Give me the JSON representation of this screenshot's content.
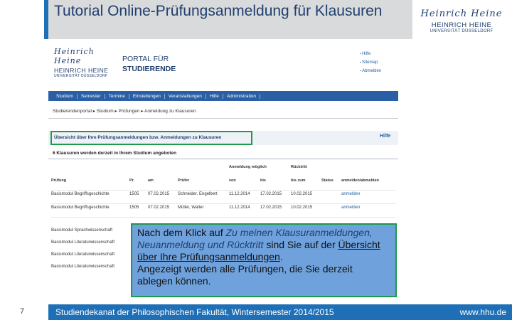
{
  "slide": {
    "title": "Tutorial Online-Prüfungsanmeldung für Klausuren",
    "page_number": "7",
    "footer_text": "Studiendekanat der Philosophischen Fakultät, Wintersemester 2014/2015",
    "footer_url": "www.hhu.de",
    "colors": {
      "accent_blue": "#1f6fb7",
      "title_band": "#d9dadb",
      "callout_bg": "#6fa1dc",
      "highlight_green": "#1f9a4a"
    }
  },
  "logo": {
    "script": "Heinrich Heine",
    "name": "HEINRICH HEINE",
    "sub": "UNIVERSITÄT DÜSSELDORF"
  },
  "portal": {
    "heading_line1": "PORTAL FÜR",
    "heading_line2": "STUDIERENDE",
    "quick_links": [
      "Hilfe",
      "Sitemap",
      "Abmelden"
    ],
    "nav_items": [
      "Studium",
      "Semester",
      "Termine",
      "Einstellungen",
      "Veranstaltungen",
      "Hilfe",
      "Administration"
    ],
    "breadcrumb": "Studierendenportal  ▸  Studium  ▸  Prüfungen  ▸  Anmeldung zu Klausuren",
    "overview_title": "Übersicht über Ihre Prüfungsanmeldungen bzw. Anmeldungen zu Klausuren",
    "help_link": "Hilfe",
    "count_line": "6 Klausuren werden derzeit in Ihrem Studium angeboten",
    "table": {
      "group_headers": {
        "anmeldung": "Anmeldung möglich",
        "rucktritt": "Rücktritt"
      },
      "headers": [
        "Prüfung",
        "Pr.",
        "am",
        "Prüfer",
        "von",
        "bis",
        "bis zum",
        "Status",
        "anmelden/abmelden"
      ],
      "rows": [
        [
          "Basismodul Begriffsgeschichte",
          "1505",
          "07.02.2015",
          "Schneider, Engelbert",
          "11.12.2014",
          "17.02.2015",
          "10.02.2015",
          "",
          "anmelden"
        ],
        [
          "Basismodul Begriffsgeschichte",
          "1505",
          "07.02.2015",
          "Müller, Walter",
          "11.12.2014",
          "17.02.2015",
          "10.02.2015",
          "",
          "anmelden"
        ]
      ],
      "extra_rows": [
        "Basismodul Sprachwissenschaft",
        "Basismodul Literaturwissenschaft",
        "Basismodul Literaturwissenschaft",
        "Basismodul Literaturwissenschaft"
      ]
    }
  },
  "callout": {
    "intro": "Nach dem Klick auf ",
    "link_text": "Zu meinen Klausuranmeldungen, Neuanmeldung und Rücktritt",
    "middle": " sind Sie auf der ",
    "underlined": "Übersicht über Ihre Prüfungsanmeldungen",
    "after": ".",
    "line2": "Angezeigt werden alle Prüfungen, die Sie derzeit ablegen können."
  }
}
